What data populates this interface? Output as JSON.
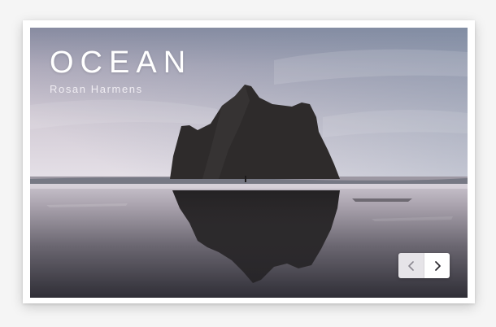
{
  "slide": {
    "title": "OCEAN",
    "author": "Rosan Harmens"
  },
  "navigation": {
    "prev_icon": "chevron-left-icon",
    "next_icon": "chevron-right-icon"
  },
  "colors": {
    "sky_top": "#8d8ea3",
    "sky_mid": "#cbc3cf",
    "horizon": "#e2dde4",
    "rock": "#2e2b2b",
    "water": "#3d3d45",
    "card_background": "#ffffff"
  }
}
